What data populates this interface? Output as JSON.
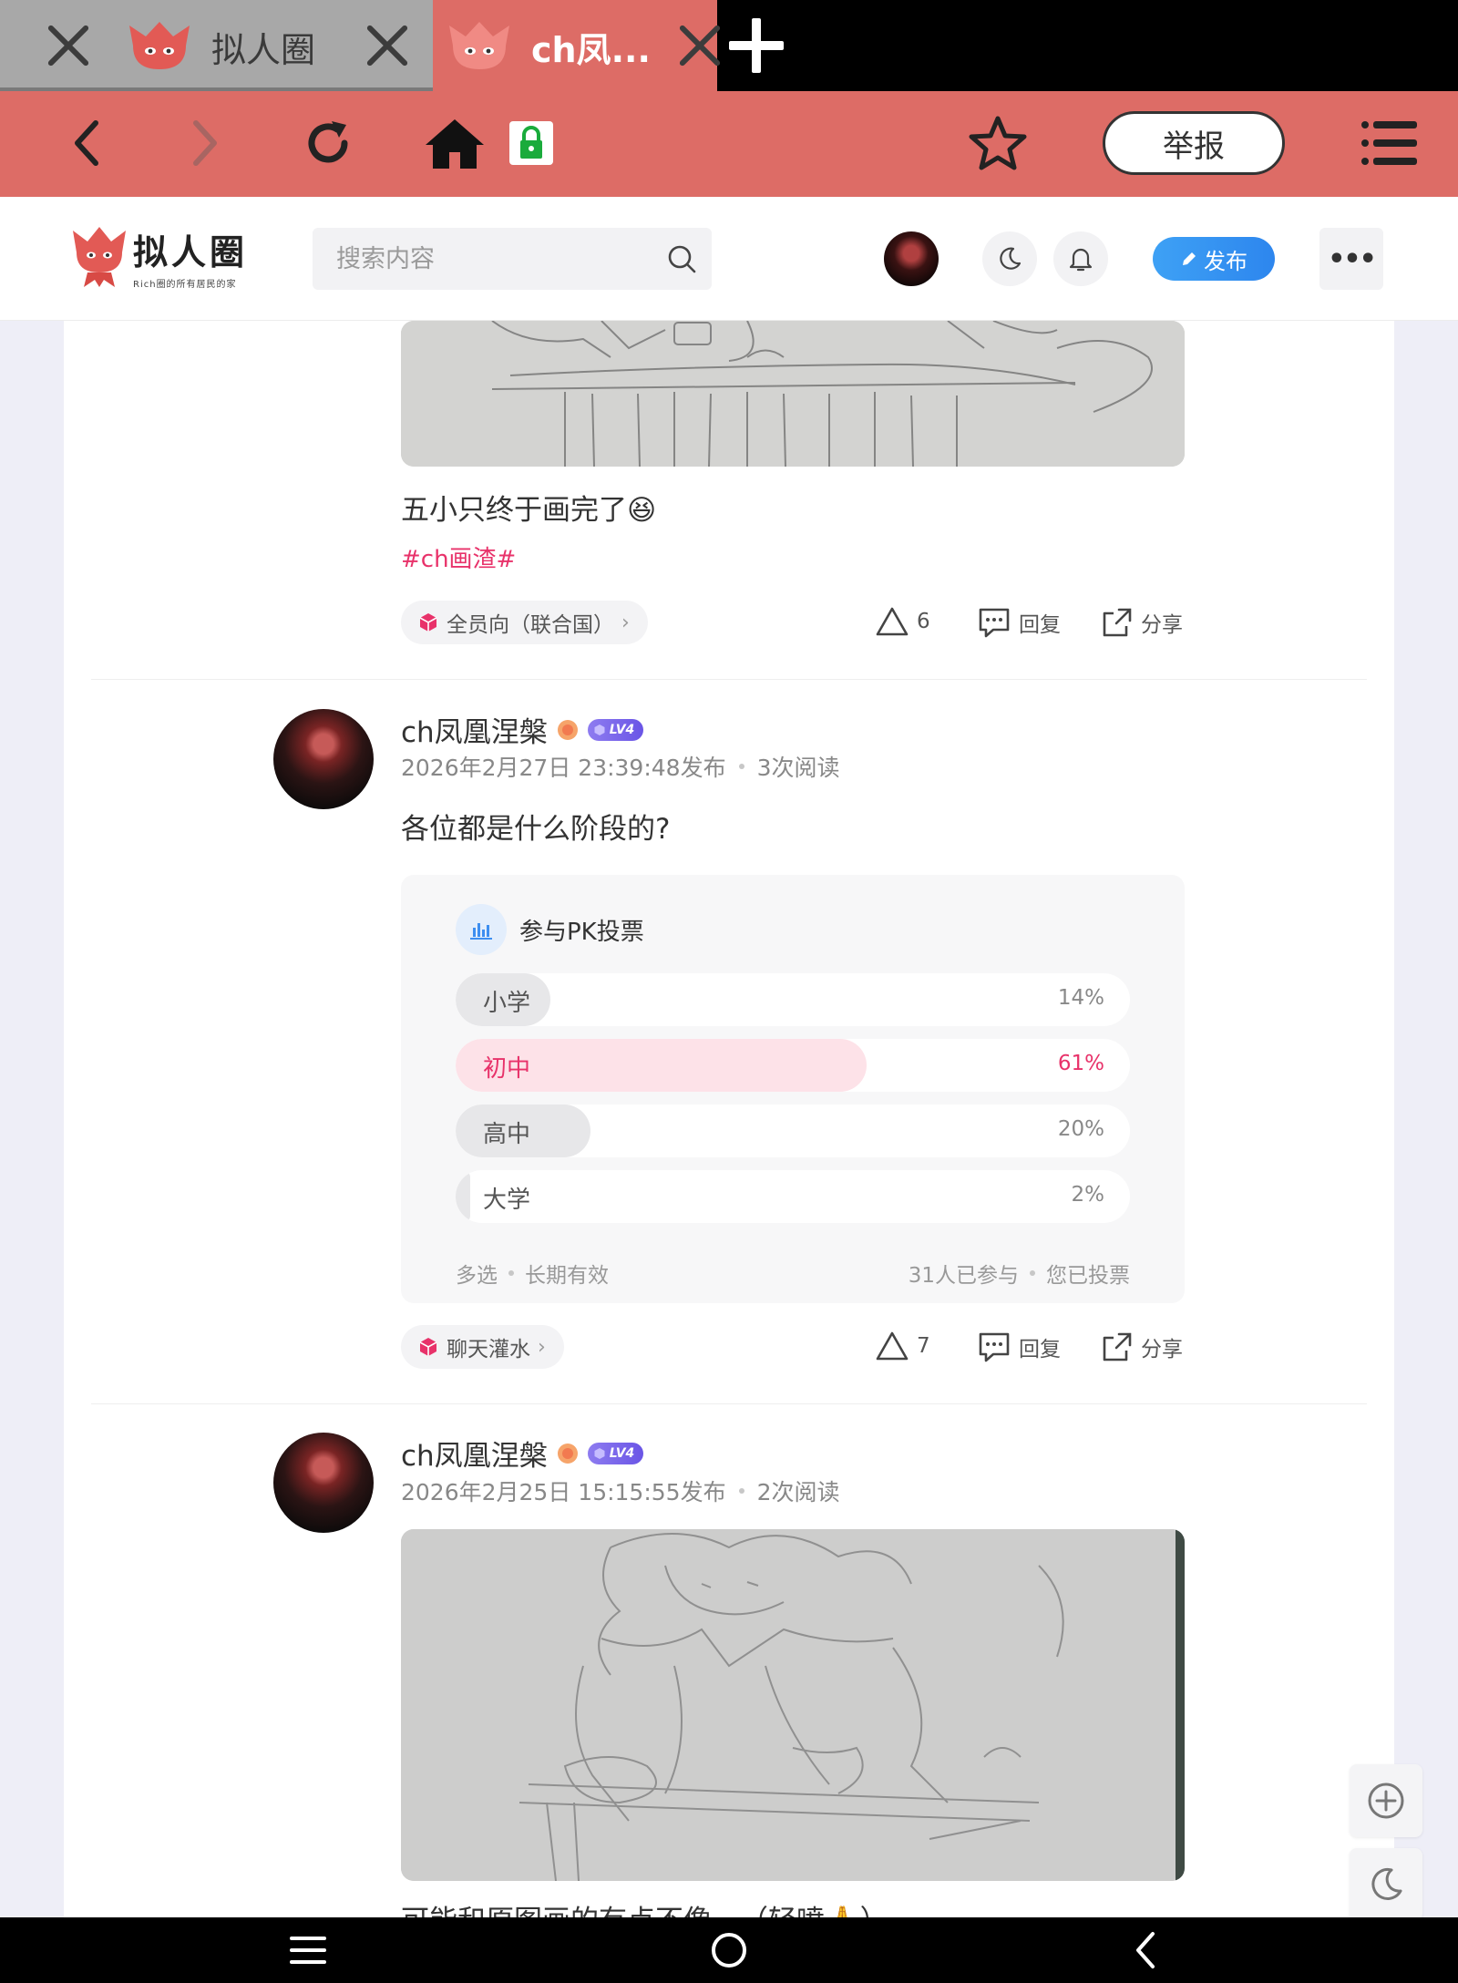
{
  "browser": {
    "tabs": [
      {
        "title": "拟人圈"
      },
      {
        "title": "ch凤..."
      }
    ],
    "report_label": "举报"
  },
  "site": {
    "brand_name": "拟人圈",
    "brand_tagline": "Rich圈的所有居民的家",
    "search_placeholder": "搜索内容",
    "publish_label": "发布",
    "more_label": "•••"
  },
  "posts": [
    {
      "text": "五小只终于画完了😆",
      "hashtag": "#ch画渣#",
      "category": "全员向（联合国）",
      "likes": "6",
      "reply_label": "回复",
      "share_label": "分享"
    },
    {
      "author": "ch凤凰涅槃",
      "level": "LV4",
      "published": "2026年2月27日 23:39:48发布",
      "views": "3次阅读",
      "text": "各位都是什么阶段的?",
      "vote": {
        "title": "参与PK投票",
        "options": [
          {
            "label": "小学",
            "percent": "14%",
            "fraction": 0.14,
            "selected": false
          },
          {
            "label": "初中",
            "percent": "61%",
            "fraction": 0.61,
            "selected": true
          },
          {
            "label": "高中",
            "percent": "20%",
            "fraction": 0.2,
            "selected": false
          },
          {
            "label": "大学",
            "percent": "2%",
            "fraction": 0.02,
            "selected": false
          }
        ],
        "mode": "多选",
        "validity": "长期有效",
        "participants": "31人已参与",
        "status": "您已投票"
      },
      "category": "聊天灌水",
      "likes": "7",
      "reply_label": "回复",
      "share_label": "分享"
    },
    {
      "author": "ch凤凰涅槃",
      "level": "LV4",
      "published": "2026年2月25日 15:15:55发布",
      "views": "2次阅读",
      "text": "可能和原图画的有点不像…（轻喷🙏）"
    }
  ],
  "colors": {
    "browser_accent": "#dd6c66",
    "hashtag": "#e8326a",
    "publish": "#2d86ee",
    "level_badge": "#6a55e6"
  }
}
